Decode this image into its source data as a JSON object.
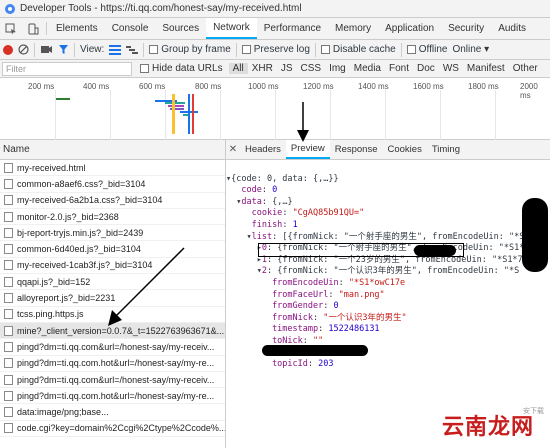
{
  "window": {
    "title": "Developer Tools - https://ti.qq.com/honest-say/my-received.html"
  },
  "devtools_tabs": [
    "Elements",
    "Console",
    "Sources",
    "Network",
    "Performance",
    "Memory",
    "Application",
    "Security",
    "Audits"
  ],
  "active_tab": "Network",
  "toolbar": {
    "view_label": "View:",
    "group_by_frame": "Group by frame",
    "preserve_log": "Preserve log",
    "disable_cache": "Disable cache",
    "offline": "Offline",
    "online": "Online"
  },
  "filter": {
    "placeholder": "Filter",
    "hide_data_urls": "Hide data URLs",
    "types": [
      "All",
      "XHR",
      "JS",
      "CSS",
      "Img",
      "Media",
      "Font",
      "Doc",
      "WS",
      "Manifest",
      "Other"
    ]
  },
  "timeline": {
    "ticks": [
      "200 ms",
      "400 ms",
      "600 ms",
      "800 ms",
      "1000 ms",
      "1200 ms",
      "1400 ms",
      "1600 ms",
      "1800 ms",
      "2000 ms"
    ]
  },
  "requests": {
    "header": "Name",
    "items": [
      "my-received.html",
      "common-a8aef6.css?_bid=3104",
      "my-received-6a2b1a.css?_bid=3104",
      "monitor-2.0.js?_bid=2368",
      "bj-report-tryjs.min.js?_bid=2439",
      "common-6d40ed.js?_bid=3104",
      "my-received-1cab3f.js?_bid=3104",
      "qqapi.js?_bid=152",
      "alloyreport.js?_bid=2231",
      "tcss.ping.https.js",
      "mine?_client_version=0.0.7&_t=1522763963671&...",
      "pingd?dm=ti.qq.com&url=/honest-say/my-receiv...",
      "pingd?dm=ti.qq.com.hot&url=/honest-say/my-re...",
      "pingd?dm=ti.qq.com&url=/honest-say/my-receiv...",
      "pingd?dm=ti.qq.com.hot&url=/honest-say/my-re...",
      "data:image/png;base...",
      "code.cgi?key=domain%2Ccgi%2Ctype%2Ccode%..."
    ],
    "selected_index": 10
  },
  "detail_tabs": [
    "Headers",
    "Preview",
    "Response",
    "Cookies",
    "Timing"
  ],
  "active_detail_tab": "Preview",
  "preview_lines": {
    "l0": "{code: 0, data: {,…}}",
    "l1_key": "code",
    "l1_val": "0",
    "l2_key": "data",
    "l2_val": "{,…}",
    "l3_key": "cookie",
    "l3_val": "\"CgAQ85b91QU=\"",
    "l4_key": "finish",
    "l4_val": "1",
    "l5_key": "list",
    "l5_val": "[{fromNick: \"一个射手座的男生\", fromEncodeUin: \"*S1*",
    "l6_idx": "0",
    "l6_val": "{fromNick: \"一个射手座的男生\", fromEncodeUin: \"*S1*",
    "l7_idx": "1",
    "l7_val": "{fromNick: \"一个23岁的男生\", fromEncodeUin: \"*S1*7",
    "l8_idx": "2",
    "l8_val": "{fromNick: \"一个认识3年的男生\", fromEncodeUin: \"*S",
    "l9_key": "fromEncodeUin",
    "l9_val": "\"*S1*owC17e",
    "l10_key": "fromFaceUrl",
    "l10_val": "\"man.png\"",
    "l11_key": "fromGender",
    "l11_val": "0",
    "l12_key": "fromNick",
    "l12_val": "\"一个认识3年的男生\"",
    "l13_key": "timestamp",
    "l13_val": "1522486131",
    "l14_key": "toNick",
    "l14_val": "\"\"",
    "l15_key": "topicId",
    "l15_val": "203"
  },
  "watermark": {
    "text": "云南龙网",
    "small": "安下载"
  },
  "colors": {
    "accent": "#03a9f4",
    "record": "#d93025",
    "key": "#881280",
    "string": "#c41a16",
    "number": "#1c00cf"
  }
}
